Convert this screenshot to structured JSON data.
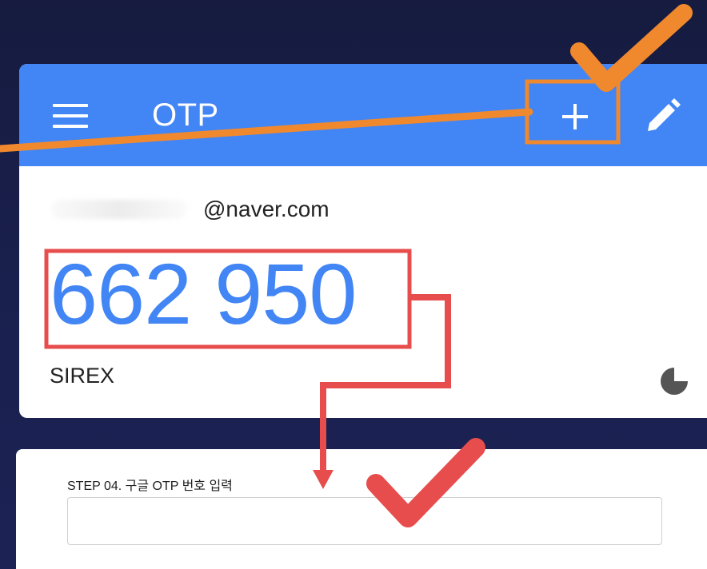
{
  "app": {
    "title": "OTP",
    "menu_icon": "hamburger-menu-icon",
    "add_icon": "plus-icon",
    "edit_icon": "pencil-icon",
    "brand_color": "#4285f4"
  },
  "otp_entry": {
    "account": "@naver.com",
    "code": "662 950",
    "issuer": "SIREX",
    "timer_icon": "countdown-pie-icon"
  },
  "step": {
    "label": "STEP 04. 구글 OTP 번호 입력",
    "input_value": "",
    "input_placeholder": ""
  },
  "annotations": {
    "orange_color": "#f0892e",
    "red_color": "#e84d4d"
  }
}
